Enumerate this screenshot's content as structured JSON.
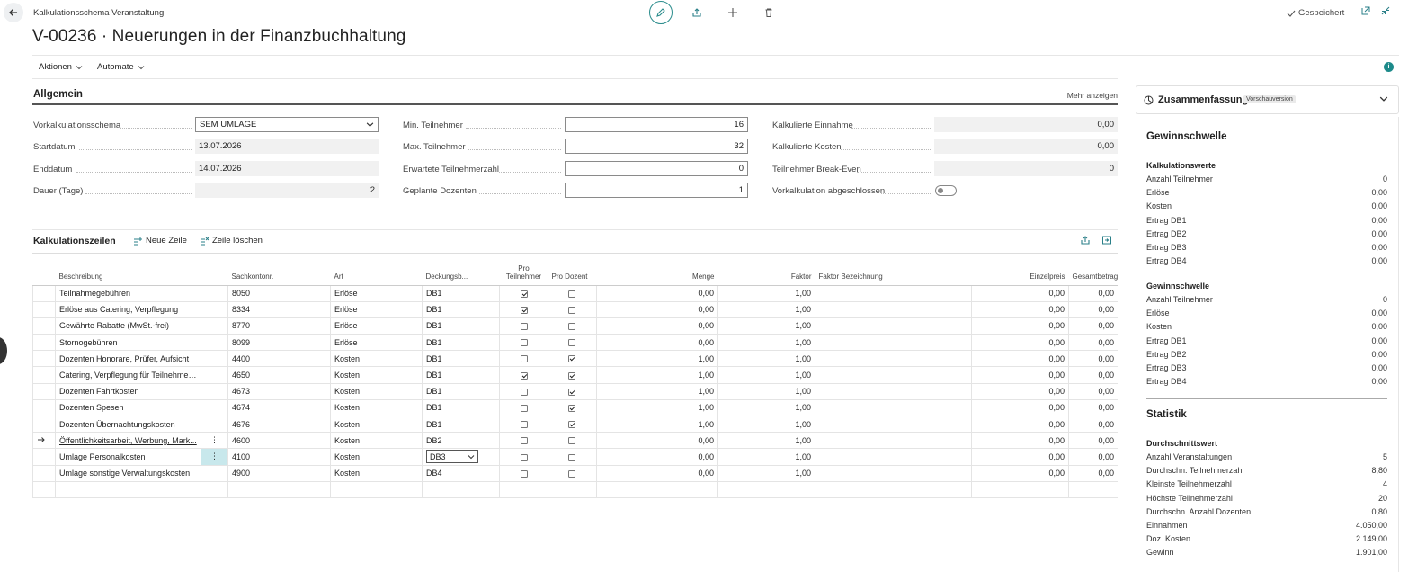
{
  "header": {
    "breadcrumb": "Kalkulationsschema Veranstaltung",
    "title": "V-00236 · Neuerungen in der Finanzbuchhaltung",
    "saved_label": "Gespeichert"
  },
  "actions": {
    "menu1": "Aktionen",
    "menu2": "Automate"
  },
  "general": {
    "section_title": "Allgemein",
    "more_label": "Mehr anzeigen",
    "fields": {
      "schema_label": "Vorkalkulationsschema",
      "schema_value": "SEM UMLAGE",
      "start_label": "Startdatum",
      "start_value": "13.07.2026",
      "end_label": "Enddatum",
      "end_value": "14.07.2026",
      "duration_label": "Dauer (Tage)",
      "duration_value": "2",
      "min_label": "Min. Teilnehmer",
      "min_value": "16",
      "max_label": "Max. Teilnehmer",
      "max_value": "32",
      "expected_label": "Erwartete Teilnehmerzahl",
      "expected_value": "0",
      "lecturers_label": "Geplante Dozenten",
      "lecturers_value": "1",
      "income_label": "Kalkulierte Einnahme",
      "income_value": "0,00",
      "costs_label": "Kalkulierte Kosten",
      "costs_value": "0,00",
      "breakeven_label": "Teilnehmer Break-Even",
      "breakeven_value": "0",
      "closed_label": "Vorkalkulation abgeschlossen"
    }
  },
  "lines": {
    "title": "Kalkulationszeilen",
    "new_line": "Neue Zeile",
    "delete_line": "Zeile löschen",
    "columns": {
      "desc": "Beschreibung",
      "account": "Sachkontonr.",
      "kind": "Art",
      "coverage": "Deckungsb...",
      "per_participant": "Pro Teilnehmer",
      "per_lecturer": "Pro Dozent",
      "qty": "Menge",
      "factor": "Faktor",
      "factor_desc": "Faktor Bezeichnung",
      "unit_price": "Einzelpreis",
      "total": "Gesamtbetrag"
    },
    "rows": [
      {
        "desc": "Teilnahmegebühren",
        "account": "8050",
        "kind": "Erlöse",
        "db": "DB1",
        "pp": true,
        "pd": false,
        "qty": "0,00",
        "factor": "1,00",
        "price": "0,00",
        "total": "0,00"
      },
      {
        "desc": "Erlöse aus Catering, Verpflegung",
        "account": "8334",
        "kind": "Erlöse",
        "db": "DB1",
        "pp": true,
        "pd": false,
        "qty": "0,00",
        "factor": "1,00",
        "price": "0,00",
        "total": "0,00"
      },
      {
        "desc": "Gewährte Rabatte (MwSt.-frei)",
        "account": "8770",
        "kind": "Erlöse",
        "db": "DB1",
        "pp": false,
        "pd": false,
        "qty": "0,00",
        "factor": "1,00",
        "price": "0,00",
        "total": "0,00"
      },
      {
        "desc": "Stornogebühren",
        "account": "8099",
        "kind": "Erlöse",
        "db": "DB1",
        "pp": false,
        "pd": false,
        "qty": "0,00",
        "factor": "1,00",
        "price": "0,00",
        "total": "0,00"
      },
      {
        "desc": "Dozenten Honorare, Prüfer, Aufsicht",
        "account": "4400",
        "kind": "Kosten",
        "db": "DB1",
        "pp": false,
        "pd": true,
        "qty": "1,00",
        "factor": "1,00",
        "price": "0,00",
        "total": "0,00"
      },
      {
        "desc": "Catering, Verpflegung für Teilnehmer...",
        "account": "4650",
        "kind": "Kosten",
        "db": "DB1",
        "pp": true,
        "pd": true,
        "qty": "1,00",
        "factor": "1,00",
        "price": "0,00",
        "total": "0,00"
      },
      {
        "desc": "Dozenten Fahrtkosten",
        "account": "4673",
        "kind": "Kosten",
        "db": "DB1",
        "pp": false,
        "pd": true,
        "qty": "1,00",
        "factor": "1,00",
        "price": "0,00",
        "total": "0,00"
      },
      {
        "desc": "Dozenten Spesen",
        "account": "4674",
        "kind": "Kosten",
        "db": "DB1",
        "pp": false,
        "pd": true,
        "qty": "1,00",
        "factor": "1,00",
        "price": "0,00",
        "total": "0,00"
      },
      {
        "desc": "Dozenten Übernachtungskosten",
        "account": "4676",
        "kind": "Kosten",
        "db": "DB1",
        "pp": false,
        "pd": true,
        "qty": "1,00",
        "factor": "1,00",
        "price": "0,00",
        "total": "0,00"
      },
      {
        "desc": "Öffentlichkeitsarbeit, Werbung, Mark...",
        "account": "4600",
        "kind": "Kosten",
        "db": "DB2",
        "pp": false,
        "pd": false,
        "qty": "0,00",
        "factor": "1,00",
        "price": "0,00",
        "total": "0,00"
      },
      {
        "desc": "Umlage Personalkosten",
        "account": "4100",
        "kind": "Kosten",
        "db": "DB3",
        "pp": false,
        "pd": false,
        "qty": "0,00",
        "factor": "1,00",
        "price": "0,00",
        "total": "0,00"
      },
      {
        "desc": "Umlage sonstige Verwaltungskosten",
        "account": "4900",
        "kind": "Kosten",
        "db": "DB4",
        "pp": false,
        "pd": false,
        "qty": "0,00",
        "factor": "1,00",
        "price": "0,00",
        "total": "0,00"
      }
    ]
  },
  "factbox": {
    "title": "Zusammenfassung",
    "badge": "Vorschauversion",
    "break_even_title": "Gewinnschwelle",
    "calc_values_title": "Kalkulationswerte",
    "calc_values": [
      {
        "label": "Anzahl Teilnehmer",
        "value": "0"
      },
      {
        "label": "Erlöse",
        "value": "0,00"
      },
      {
        "label": "Kosten",
        "value": "0,00"
      },
      {
        "label": "Ertrag DB1",
        "value": "0,00"
      },
      {
        "label": "Ertrag DB2",
        "value": "0,00"
      },
      {
        "label": "Ertrag DB3",
        "value": "0,00"
      },
      {
        "label": "Ertrag DB4",
        "value": "0,00"
      }
    ],
    "break_even_sub": "Gewinnschwelle",
    "break_even_values": [
      {
        "label": "Anzahl Teilnehmer",
        "value": "0"
      },
      {
        "label": "Erlöse",
        "value": "0,00"
      },
      {
        "label": "Kosten",
        "value": "0,00"
      },
      {
        "label": "Ertrag DB1",
        "value": "0,00"
      },
      {
        "label": "Ertrag DB2",
        "value": "0,00"
      },
      {
        "label": "Ertrag DB3",
        "value": "0,00"
      },
      {
        "label": "Ertrag DB4",
        "value": "0,00"
      }
    ],
    "stats_title": "Statistik",
    "avg_title": "Durchschnittswert",
    "avg_values": [
      {
        "label": "Anzahl Veranstaltungen",
        "value": "5"
      },
      {
        "label": "Durchschn. Teilnehmerzahl",
        "value": "8,80"
      },
      {
        "label": "Kleinste Teilnehmerzahl",
        "value": "4"
      },
      {
        "label": "Höchste Teilnehmerzahl",
        "value": "20"
      },
      {
        "label": "Durchschn. Anzahl Dozenten",
        "value": "0,80"
      },
      {
        "label": "Einnahmen",
        "value": "4.050,00"
      },
      {
        "label": "Doz. Kosten",
        "value": "2.149,00"
      },
      {
        "label": "Gewinn",
        "value": "1.901,00"
      }
    ]
  }
}
